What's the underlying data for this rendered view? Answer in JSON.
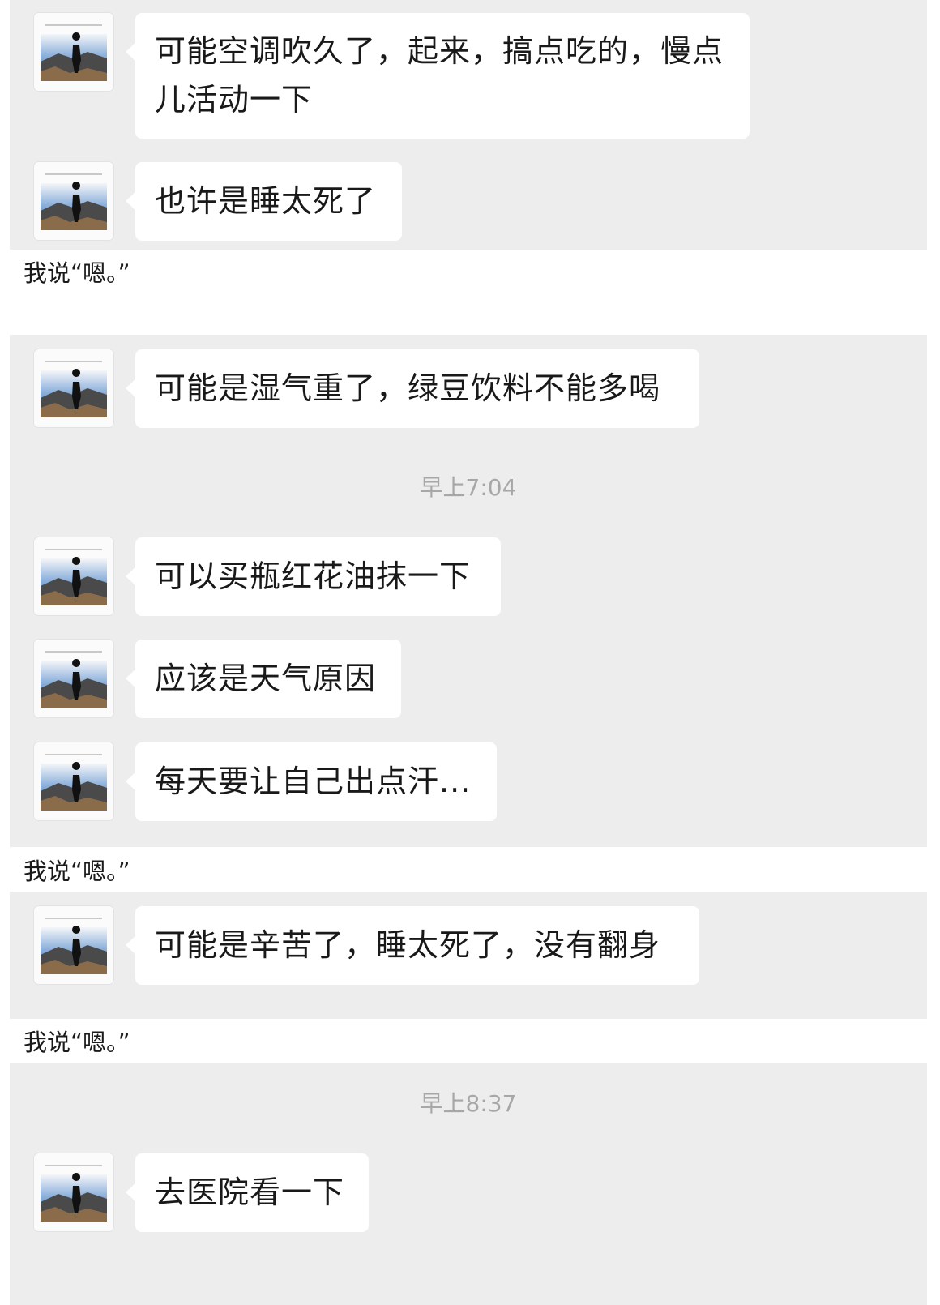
{
  "captions": [
    "我说“嗯。”",
    "我说“嗯。”",
    "我说“嗯。”"
  ],
  "timestamps": [
    "早上7:04",
    "早上8:37"
  ],
  "messages": [
    "可能空调吹久了，起来，搞点吃的，慢点儿活动一下",
    "也许是睡太死了",
    "可能是湿气重了，绿豆饮料不能多喝",
    "可以买瓶红花油抹一下",
    "应该是天气原因",
    "每天要让自己出点汗...",
    "可能是辛苦了，睡太死了，没有翻身",
    "去医院看一下"
  ],
  "avatar_icon": "mountain-silhouette-avatar"
}
